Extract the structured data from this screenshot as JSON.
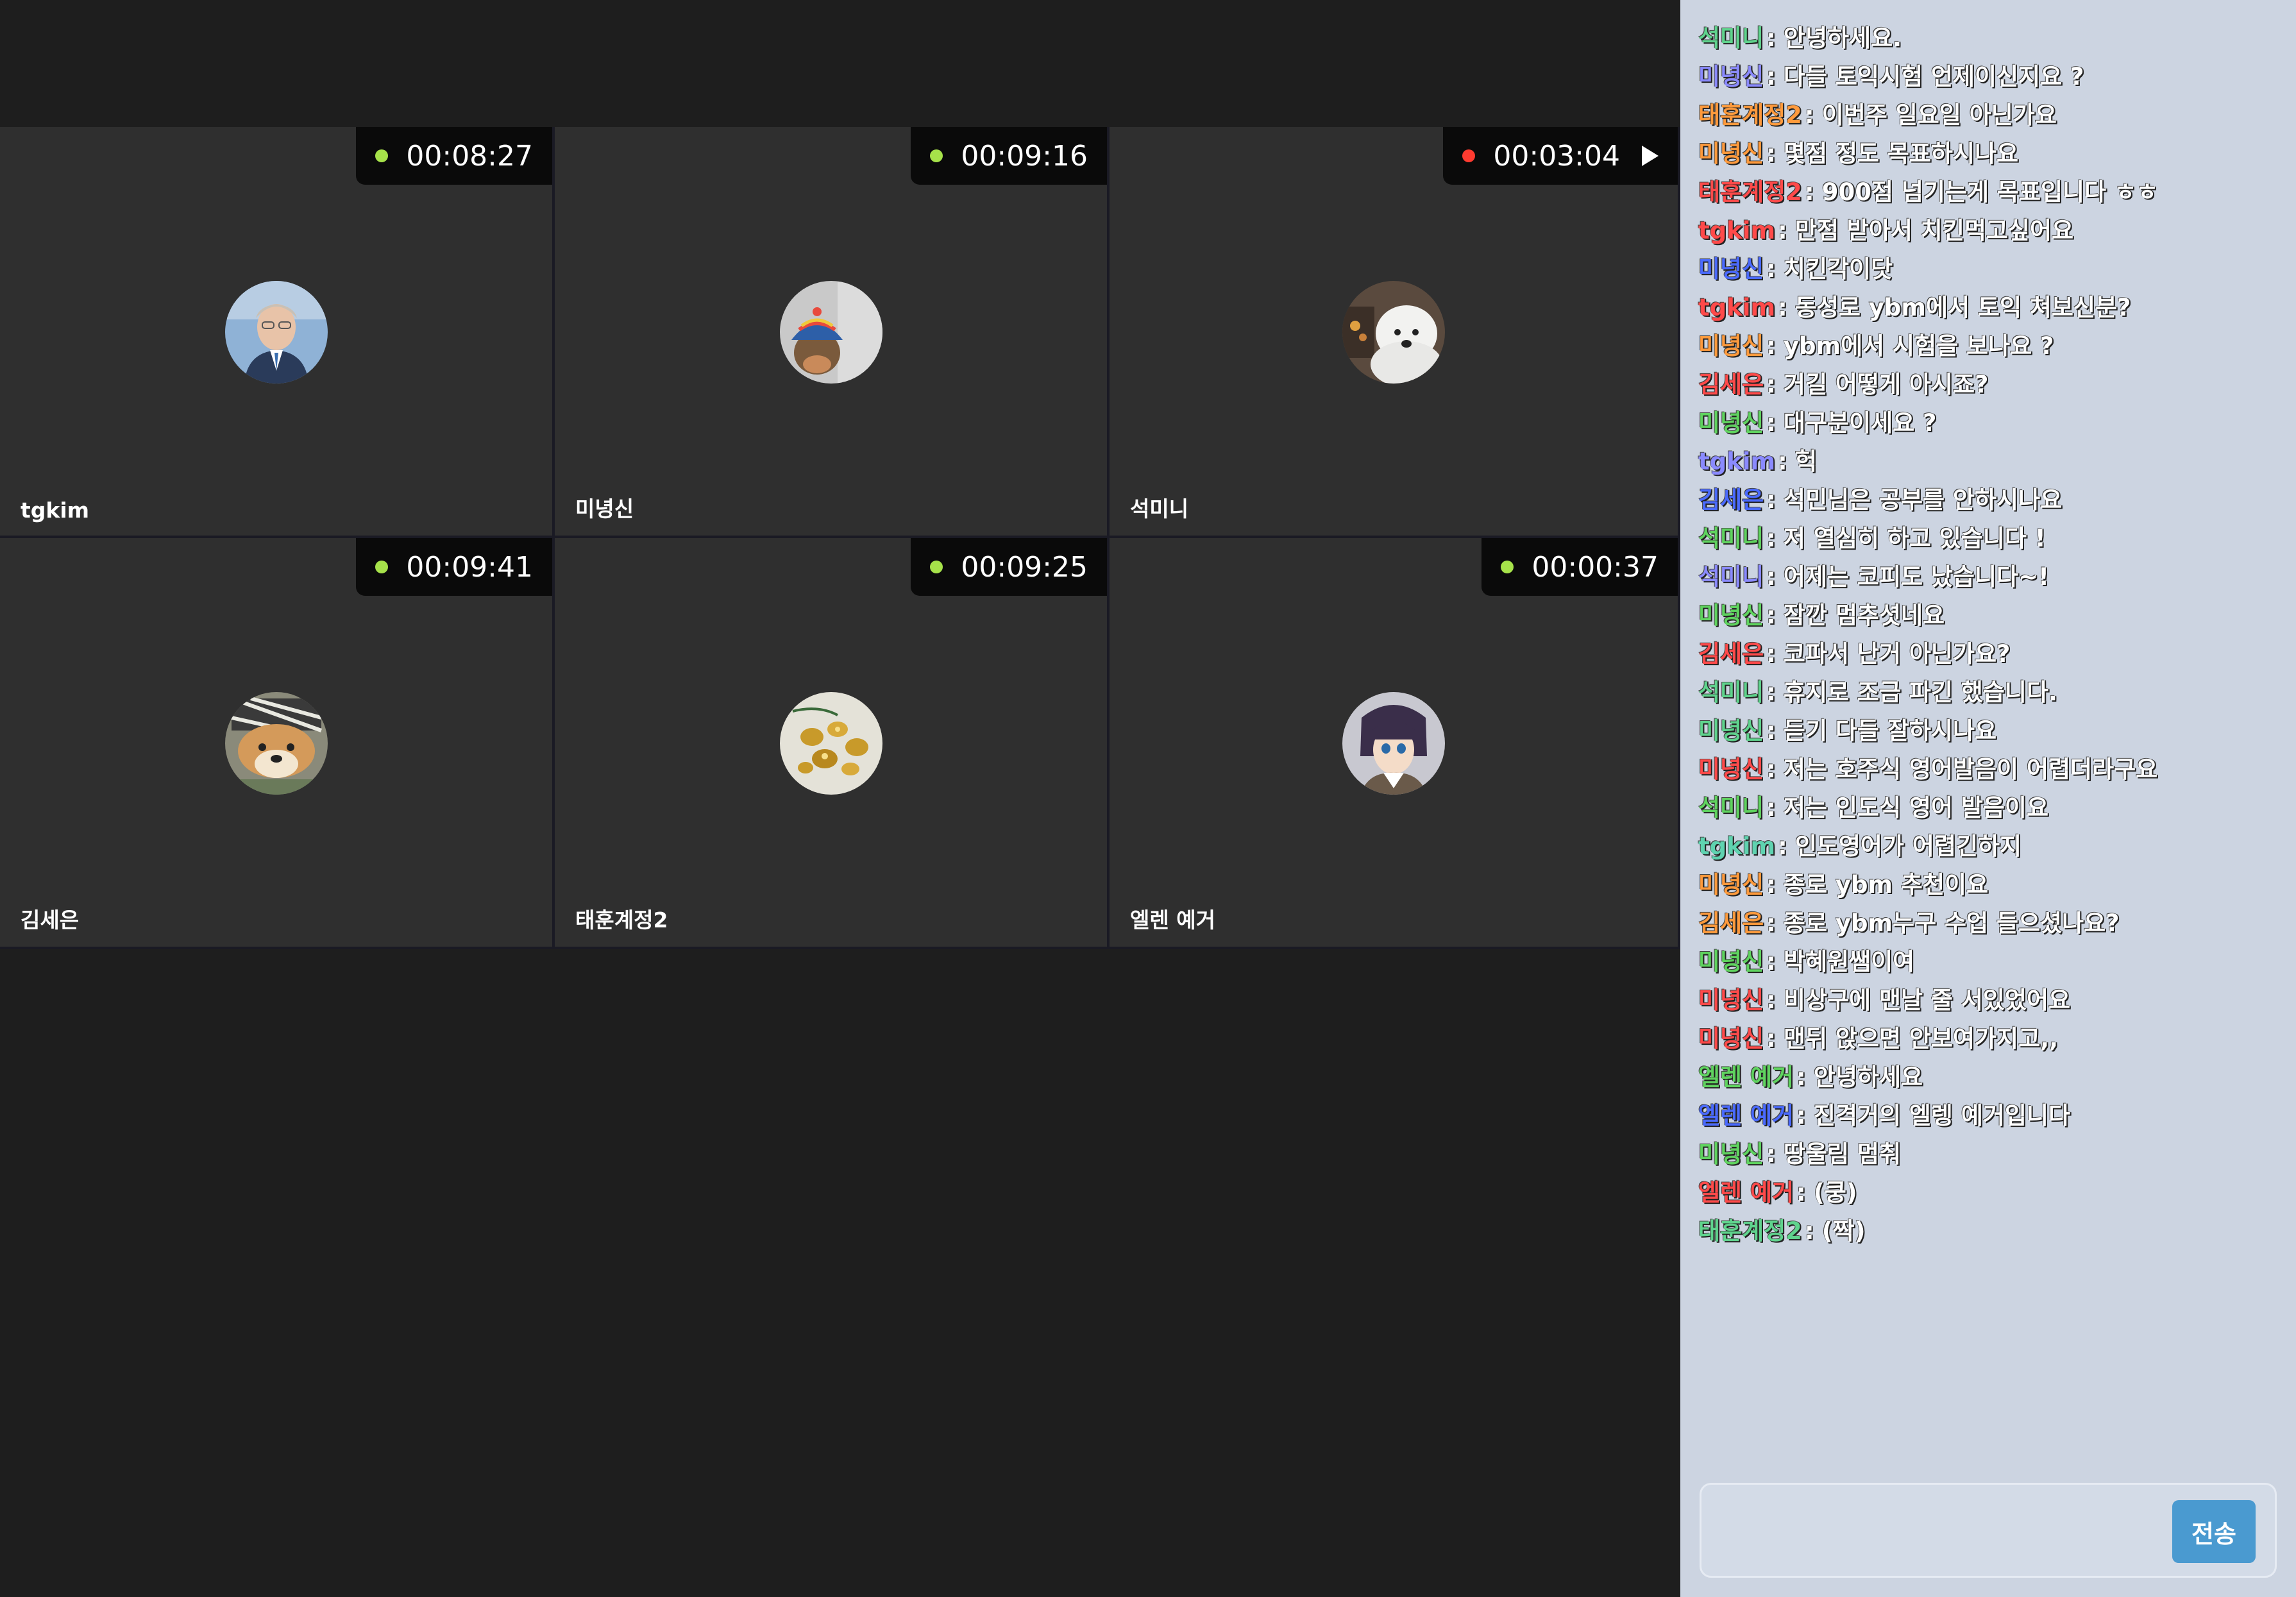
{
  "tiles": [
    {
      "name": "tgkim",
      "timer": "00:08:27",
      "status_color": "#a6e24a",
      "avatar": "man-portrait",
      "play": false
    },
    {
      "name": "미녕신",
      "timer": "00:09:16",
      "status_color": "#a6e24a",
      "avatar": "doll-in-hat",
      "play": false
    },
    {
      "name": "석미니",
      "timer": "00:03:04",
      "status_color": "#ff3b30",
      "avatar": "white-dog",
      "play": true
    },
    {
      "name": "김세은",
      "timer": "00:09:41",
      "status_color": "#a6e24a",
      "avatar": "shiba-dog",
      "play": false
    },
    {
      "name": "태훈계정2",
      "timer": "00:09:25",
      "status_color": "#a6e24a",
      "avatar": "gold-ornaments",
      "play": false
    },
    {
      "name": "엘렌 예거",
      "timer": "00:00:37",
      "status_color": "#a6e24a",
      "avatar": "anime-character",
      "play": false
    }
  ],
  "chat": {
    "messages": [
      {
        "user": "석미니",
        "sep": ":",
        "text": "안녕하세요.",
        "color": "#5fd38d"
      },
      {
        "user": "미녕신",
        "sep": ":",
        "text": "다들 토익시험 언제이신지요 ?",
        "color": "#8a8aff"
      },
      {
        "user": "태훈계정2",
        "sep": ":",
        "text": "이번주 일요일 아닌가요",
        "color": "#ff9a3c"
      },
      {
        "user": "미녕신",
        "sep": ":",
        "text": "몇점 정도 목표하시나요",
        "color": "#ff9a3c"
      },
      {
        "user": "태훈계정2",
        "sep": ":",
        "text": "900점 넘기는게 목표입니다 ㅎㅎ",
        "color": "#ff4a4a"
      },
      {
        "user": "tgkim",
        "sep": ":",
        "text": "만점 받아서 치킨먹고싶어요",
        "color": "#ff4a4a"
      },
      {
        "user": "미녕신",
        "sep": ":",
        "text": "치킨각이닷",
        "color": "#4a6aff"
      },
      {
        "user": "tgkim",
        "sep": ":",
        "text": "동성로 ybm에서 토익 쳐보신분?",
        "color": "#ff4a4a"
      },
      {
        "user": "미녕신",
        "sep": ":",
        "text": "ybm에서 시험을 보나요 ?",
        "color": "#ff9a3c"
      },
      {
        "user": "김세은",
        "sep": ":",
        "text": "거길 어떻게 아시죠?",
        "color": "#ff4a4a"
      },
      {
        "user": "미녕신",
        "sep": ":",
        "text": "대구분이세요 ?",
        "color": "#5fd35f"
      },
      {
        "user": "tgkim",
        "sep": ":",
        "text": "헉",
        "color": "#8a8aff"
      },
      {
        "user": "김세은",
        "sep": ":",
        "text": "석민님은 공부를 안하시나요",
        "color": "#4a6aff"
      },
      {
        "user": "석미니",
        "sep": ":",
        "text": "저 열심히 하고 있습니다 !",
        "color": "#5fd35f"
      },
      {
        "user": "석미니",
        "sep": ":",
        "text": "어제는 코피도 났습니다~!",
        "color": "#8a8aff"
      },
      {
        "user": "미녕신",
        "sep": ":",
        "text": "잠깐 멈추셧네요",
        "color": "#5fd35f"
      },
      {
        "user": "김세은",
        "sep": ":",
        "text": "코파서 난거 아닌가요?",
        "color": "#ff4a4a"
      },
      {
        "user": "석미니",
        "sep": ":",
        "text": "휴지로 조금 파긴 했습니다.",
        "color": "#5fd38d"
      },
      {
        "user": "미녕신",
        "sep": ":",
        "text": "듣기 다들 잘하시나요",
        "color": "#5fd38d"
      },
      {
        "user": "미녕신",
        "sep": ":",
        "text": "저는 호주식 영어발음이 어렵더라구요",
        "color": "#ff4a4a"
      },
      {
        "user": "석미니",
        "sep": ":",
        "text": "저는 인도식 영어 발음이요",
        "color": "#5fd35f"
      },
      {
        "user": "tgkim",
        "sep": ":",
        "text": "인도영어가 어렵긴하지",
        "color": "#5fd3b0"
      },
      {
        "user": "미녕신",
        "sep": ":",
        "text": "종로 ybm 추천이요",
        "color": "#ff9a3c"
      },
      {
        "user": "김세은",
        "sep": ":",
        "text": "종로 ybm누구 수업 들으셨나요?",
        "color": "#ff9a3c"
      },
      {
        "user": "미녕신",
        "sep": ":",
        "text": "박혜원쌤이여",
        "color": "#5fd35f"
      },
      {
        "user": "미녕신",
        "sep": ":",
        "text": "비상구에 맨날 줄 서있었어요",
        "color": "#ff4a4a"
      },
      {
        "user": "미녕신",
        "sep": ":",
        "text": "맨뒤 앉으면 안보여가지고,,",
        "color": "#ff4a4a"
      },
      {
        "user": "엘렌 예거",
        "sep": ":",
        "text": "안녕하세요",
        "color": "#5fd35f"
      },
      {
        "user": "엘렌 예거",
        "sep": ":",
        "text": "진격거의 엘렝 예거입니다",
        "color": "#4a6aff"
      },
      {
        "user": "미녕신",
        "sep": ":",
        "text": "땅울림 멈춰",
        "color": "#5fd35f"
      },
      {
        "user": "엘렌 예거",
        "sep": ":",
        "text": "(쿵)",
        "color": "#ff4a4a"
      },
      {
        "user": "태훈계정2",
        "sep": ":",
        "text": "(짝)",
        "color": "#5fd38d"
      }
    ],
    "input_value": "",
    "send_label": "전송"
  }
}
